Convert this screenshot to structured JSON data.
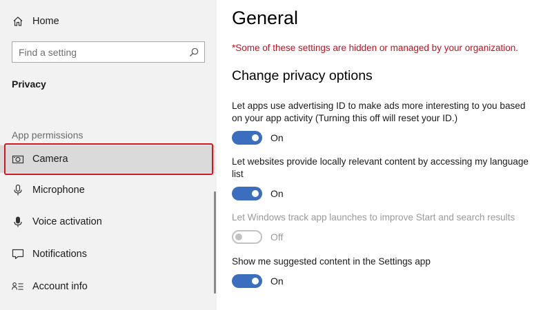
{
  "sidebar": {
    "home_label": "Home",
    "search": {
      "placeholder": "Find a setting",
      "value": ""
    },
    "section_title": "Privacy",
    "group_title": "App permissions",
    "items": [
      {
        "label": "Camera",
        "icon": "camera-icon",
        "selected": true
      },
      {
        "label": "Microphone",
        "icon": "microphone-icon",
        "selected": false
      },
      {
        "label": "Voice activation",
        "icon": "voice-activation-icon",
        "selected": false
      },
      {
        "label": "Notifications",
        "icon": "notifications-icon",
        "selected": false
      },
      {
        "label": "Account info",
        "icon": "account-info-icon",
        "selected": false
      }
    ]
  },
  "main": {
    "title": "General",
    "org_notice": "*Some of these settings are hidden or managed by your organization.",
    "section_title": "Change privacy options",
    "settings": [
      {
        "description": "Let apps use advertising ID to make ads more interesting to you based on your app activity (Turning this off will reset your ID.)",
        "state": "On",
        "enabled": true
      },
      {
        "description": "Let websites provide locally relevant content by accessing my language list",
        "state": "On",
        "enabled": true
      },
      {
        "description": "Let Windows track app launches to improve Start and search results",
        "state": "Off",
        "enabled": false
      },
      {
        "description": "Show me suggested content in the Settings app",
        "state": "On",
        "enabled": true
      }
    ]
  },
  "colors": {
    "accent": "#3b6fbd",
    "warning_text": "#c50f1f",
    "highlight_border": "#d4131b",
    "sidebar_bg": "#f2f2f2",
    "selected_bg": "#dadada"
  }
}
